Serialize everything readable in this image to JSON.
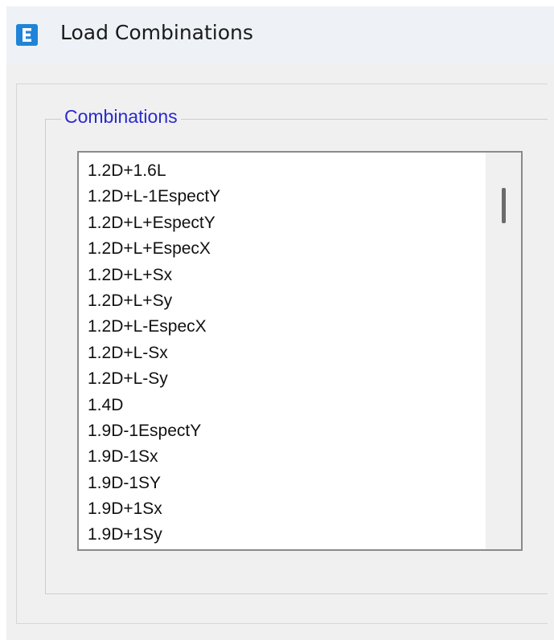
{
  "window": {
    "title": "Load Combinations",
    "app_icon_letter": "E",
    "accent_color": "#1f84d8"
  },
  "group": {
    "label": "Combinations",
    "label_color": "#2a2ad0"
  },
  "combinations": {
    "items": [
      "1.2D+1.6L",
      "1.2D+L-1EspectY",
      "1.2D+L+EspectY",
      "1.2D+L+EspecX",
      "1.2D+L+Sx",
      "1.2D+L+Sy",
      "1.2D+L-EspecX",
      "1.2D+L-Sx",
      "1.2D+L-Sy",
      "1.4D",
      "1.9D-1EspectY",
      "1.9D-1Sx",
      "1.9D-1SY",
      "1.9D+1Sx",
      "1.9D+1Sy"
    ]
  }
}
